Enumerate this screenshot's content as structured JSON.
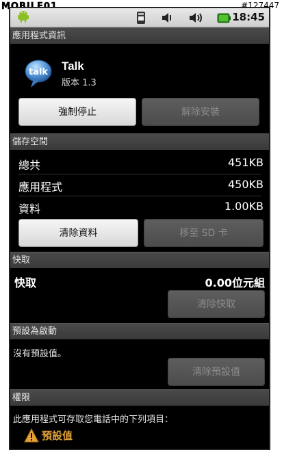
{
  "watermark": {
    "left": "MOBILE01",
    "right": "#127447"
  },
  "status_bar": {
    "time": "18:45",
    "icons": [
      "android-notification-icon",
      "sim-icon",
      "vibrate-icon",
      "volume-icon",
      "battery-icon"
    ]
  },
  "app_info": {
    "title": "應用程式資訊",
    "app_name": "Talk",
    "version": "版本 1.3",
    "icon_text": "talk",
    "force_stop_label": "強制停止",
    "uninstall_label": "解除安裝"
  },
  "storage": {
    "header": "儲存空間",
    "rows": [
      {
        "label": "總共",
        "value": "451KB"
      },
      {
        "label": "應用程式",
        "value": "450KB"
      },
      {
        "label": "資料",
        "value": "1.00KB"
      }
    ],
    "clear_data_label": "清除資料",
    "move_to_sd_label": "移至 SD 卡"
  },
  "cache": {
    "header": "快取",
    "label": "快取",
    "value": "0.00位元組",
    "clear_cache_label": "清除快取"
  },
  "defaults": {
    "header": "預設為啟動",
    "text": "沒有預設值。",
    "clear_defaults_label": "清除預設值"
  },
  "permissions": {
    "header": "權限",
    "text": "此應用程式可存取您電話中的下列項目：",
    "item_label": "預設值"
  },
  "colors": {
    "accent_warning": "#e2a23a",
    "section_header": "#3f3f3f"
  }
}
